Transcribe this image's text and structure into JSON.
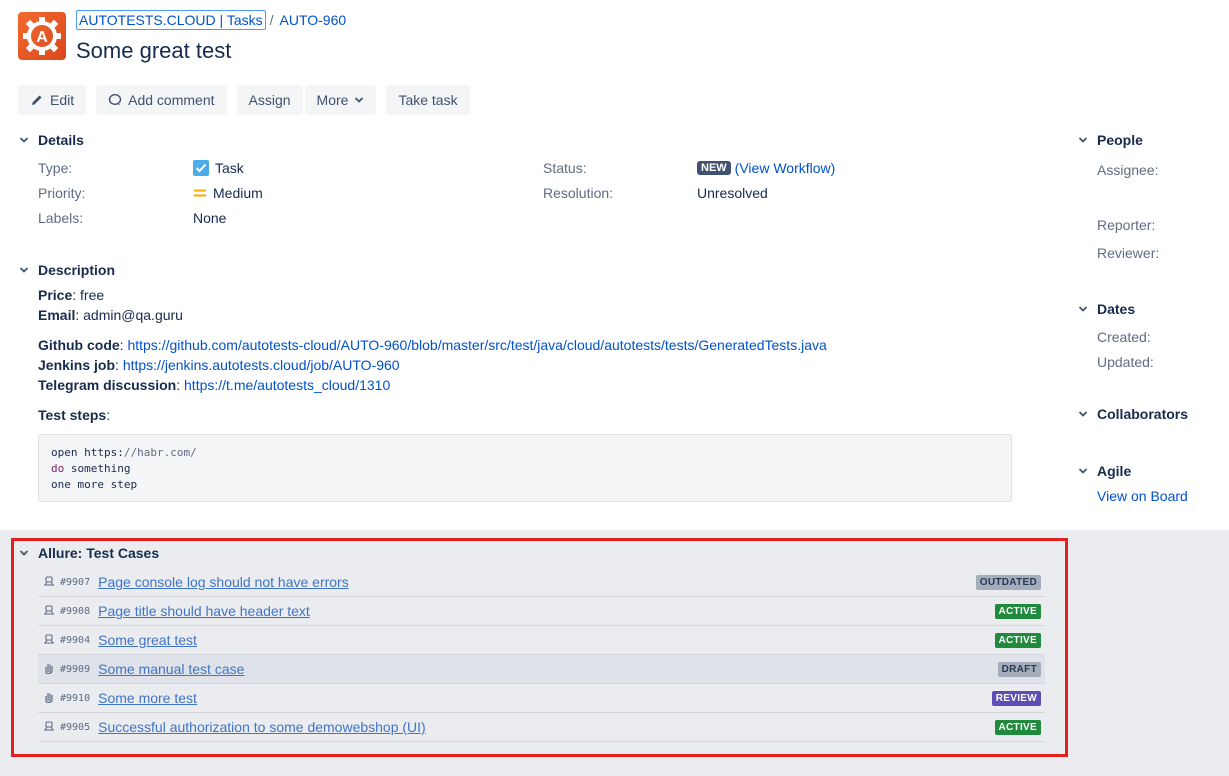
{
  "breadcrumbs": {
    "project": "AUTOTESTS.CLOUD | Tasks",
    "separator": "/",
    "issue_key": "AUTO-960"
  },
  "issue": {
    "summary": "Some great test"
  },
  "toolbar": {
    "edit": "Edit",
    "add_comment": "Add comment",
    "assign": "Assign",
    "more": "More",
    "take_task": "Take task"
  },
  "details": {
    "title": "Details",
    "type_label": "Type:",
    "type_value": "Task",
    "priority_label": "Priority:",
    "priority_value": "Medium",
    "labels_label": "Labels:",
    "labels_value": "None",
    "status_label": "Status:",
    "status_value": "NEW",
    "status_link": "(View Workflow)",
    "resolution_label": "Resolution:",
    "resolution_value": "Unresolved"
  },
  "description": {
    "title": "Description",
    "price_label": "Price",
    "price_value": ": free",
    "email_label": "Email",
    "email_value": ": admin@qa.guru",
    "github_label": "Github code",
    "github_sep": ": ",
    "github_url": "https://github.com/autotests-cloud/AUTO-960/blob/master/src/test/java/cloud/autotests/tests/GeneratedTests.java",
    "jenkins_label": "Jenkins job",
    "jenkins_sep": ": ",
    "jenkins_url": "https://jenkins.autotests.cloud/job/AUTO-960",
    "telegram_label": "Telegram discussion",
    "telegram_sep": ": ",
    "telegram_url": "https://t.me/autotests_cloud/1310",
    "steps_label": "Test steps",
    "steps_sep": ":",
    "code": {
      "line1_a": "open https:",
      "line1_b": "//habr.com/",
      "line2_kw": "do",
      "line2_rest": " something",
      "line3": "one more step"
    }
  },
  "allure": {
    "title": "Allure: Test Cases",
    "rows": [
      {
        "icon": "automated-icon",
        "id": "#9907",
        "name": "Page console log should not have errors",
        "status": "OUTDATED",
        "status_color": "#a5adba",
        "status_text_color": "#253858"
      },
      {
        "icon": "automated-icon",
        "id": "#9908",
        "name": "Page title should have header text",
        "status": "ACTIVE",
        "status_color": "#1f8a3c",
        "status_text_color": "#ffffff"
      },
      {
        "icon": "automated-icon",
        "id": "#9904",
        "name": "Some great test",
        "status": "ACTIVE",
        "status_color": "#1f8a3c",
        "status_text_color": "#ffffff"
      },
      {
        "icon": "manual-hand-icon",
        "id": "#9909",
        "name": "Some manual test case",
        "status": "DRAFT",
        "status_color": "#a5adba",
        "status_text_color": "#253858"
      },
      {
        "icon": "manual-hand-icon",
        "id": "#9910",
        "name": "Some more test",
        "status": "REVIEW",
        "status_color": "#5e4db2",
        "status_text_color": "#ffffff"
      },
      {
        "icon": "automated-icon",
        "id": "#9905",
        "name": "Successful authorization to some demowebshop (UI)",
        "status": "ACTIVE",
        "status_color": "#1f8a3c",
        "status_text_color": "#ffffff"
      }
    ]
  },
  "sidebar": {
    "people_title": "People",
    "assignee_label": "Assignee:",
    "reporter_label": "Reporter:",
    "reviewer_label": "Reviewer:",
    "dates_title": "Dates",
    "created_label": "Created:",
    "updated_label": "Updated:",
    "collaborators_title": "Collaborators",
    "agile_title": "Agile",
    "view_on_board": "View on Board"
  }
}
